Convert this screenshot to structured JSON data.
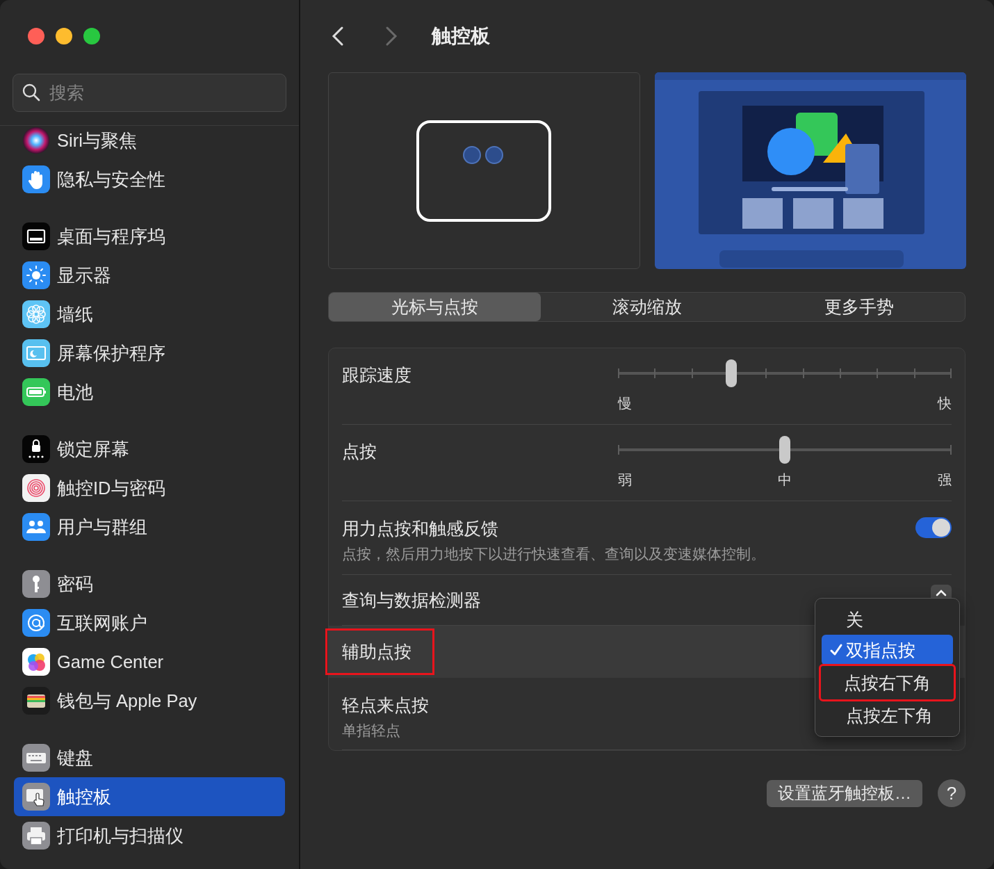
{
  "sidebar": {
    "search": {
      "placeholder": "搜索"
    },
    "groups": [
      [
        {
          "label": "Siri与聚焦",
          "selected": false
        },
        {
          "label": "隐私与安全性",
          "selected": false
        }
      ],
      [
        {
          "label": "桌面与程序坞",
          "selected": false
        },
        {
          "label": "显示器",
          "selected": false
        },
        {
          "label": "墙纸",
          "selected": false
        },
        {
          "label": "屏幕保护程序",
          "selected": false
        },
        {
          "label": "电池",
          "selected": false
        }
      ],
      [
        {
          "label": "锁定屏幕",
          "selected": false
        },
        {
          "label": "触控ID与密码",
          "selected": false
        },
        {
          "label": "用户与群组",
          "selected": false
        }
      ],
      [
        {
          "label": "密码",
          "selected": false
        },
        {
          "label": "互联网账户",
          "selected": false
        },
        {
          "label": "Game Center",
          "selected": false
        },
        {
          "label": "钱包与 Apple Pay",
          "selected": false
        }
      ],
      [
        {
          "label": "键盘",
          "selected": false
        },
        {
          "label": "触控板",
          "selected": true
        },
        {
          "label": "打印机与扫描仪",
          "selected": false
        }
      ]
    ]
  },
  "header": {
    "back_enabled": true,
    "forward_enabled": false,
    "title": "触控板"
  },
  "tabs": [
    {
      "label": "光标与点按",
      "selected": true
    },
    {
      "label": "滚动缩放",
      "selected": false
    },
    {
      "label": "更多手势",
      "selected": false
    }
  ],
  "settings": [
    {
      "kind": "slider",
      "label": "跟踪速度",
      "level": 0.34,
      "scale": [
        "慢",
        "快"
      ]
    },
    {
      "kind": "slider",
      "label": "点按",
      "level": 0.5,
      "scale": [
        "弱",
        "中",
        "强"
      ]
    },
    {
      "kind": "toggle",
      "label": "用力点按和触感反馈",
      "description": "点按，然后用力地按下以进行快速查看、查询以及变速媒体控制。",
      "on": true
    },
    {
      "kind": "popup",
      "label": "查询与数据检测器"
    },
    {
      "kind": "popup",
      "label": "辅助点按",
      "highlighted": true,
      "menu": [
        {
          "label": "关",
          "selected": false,
          "highlighted": false
        },
        {
          "label": "双指点按",
          "selected": true,
          "highlighted": false
        },
        {
          "label": "点按右下角",
          "selected": false,
          "highlighted": true
        },
        {
          "label": "点按左下角",
          "selected": false,
          "highlighted": false
        }
      ]
    },
    {
      "kind": "popup",
      "label": "轻点来点按",
      "description": "单指轻点"
    }
  ],
  "footer": {
    "button": "设置蓝牙触控板…",
    "help": "?"
  }
}
